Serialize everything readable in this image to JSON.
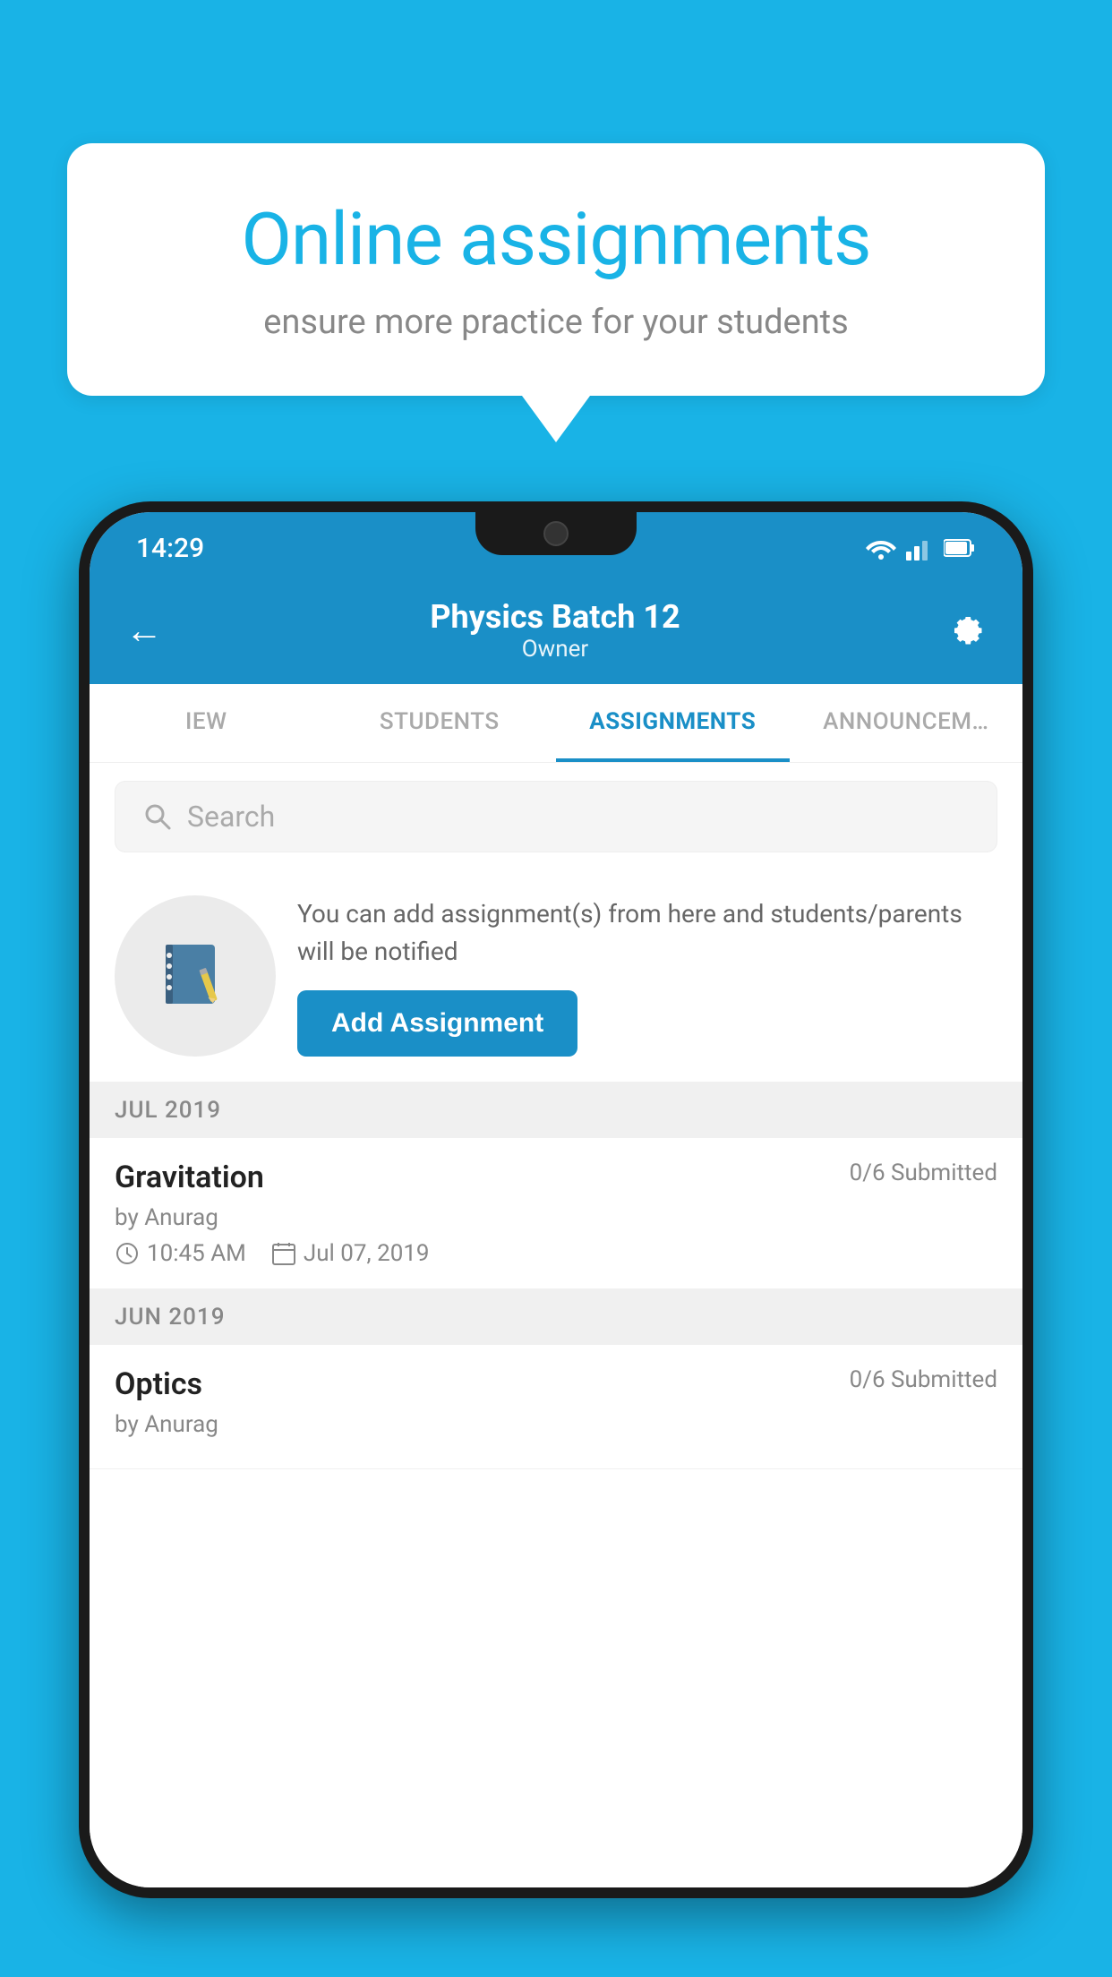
{
  "background_color": "#19b3e6",
  "speech_bubble": {
    "title": "Online assignments",
    "subtitle": "ensure more practice for your students"
  },
  "phone": {
    "status_bar": {
      "time": "14:29"
    },
    "header": {
      "title": "Physics Batch 12",
      "subtitle": "Owner",
      "back_label": "←",
      "settings_label": "⚙"
    },
    "tabs": [
      {
        "label": "IEW",
        "active": false
      },
      {
        "label": "STUDENTS",
        "active": false
      },
      {
        "label": "ASSIGNMENTS",
        "active": true
      },
      {
        "label": "ANNOUNCEM…",
        "active": false
      }
    ],
    "search": {
      "placeholder": "Search"
    },
    "promo": {
      "text": "You can add assignment(s) from here and students/parents will be notified",
      "button_label": "Add Assignment"
    },
    "assignments": [
      {
        "month": "JUL 2019",
        "items": [
          {
            "name": "Gravitation",
            "submitted": "0/6 Submitted",
            "author": "by Anurag",
            "time": "10:45 AM",
            "date": "Jul 07, 2019"
          }
        ]
      },
      {
        "month": "JUN 2019",
        "items": [
          {
            "name": "Optics",
            "submitted": "0/6 Submitted",
            "author": "by Anurag",
            "time": "",
            "date": ""
          }
        ]
      }
    ]
  }
}
